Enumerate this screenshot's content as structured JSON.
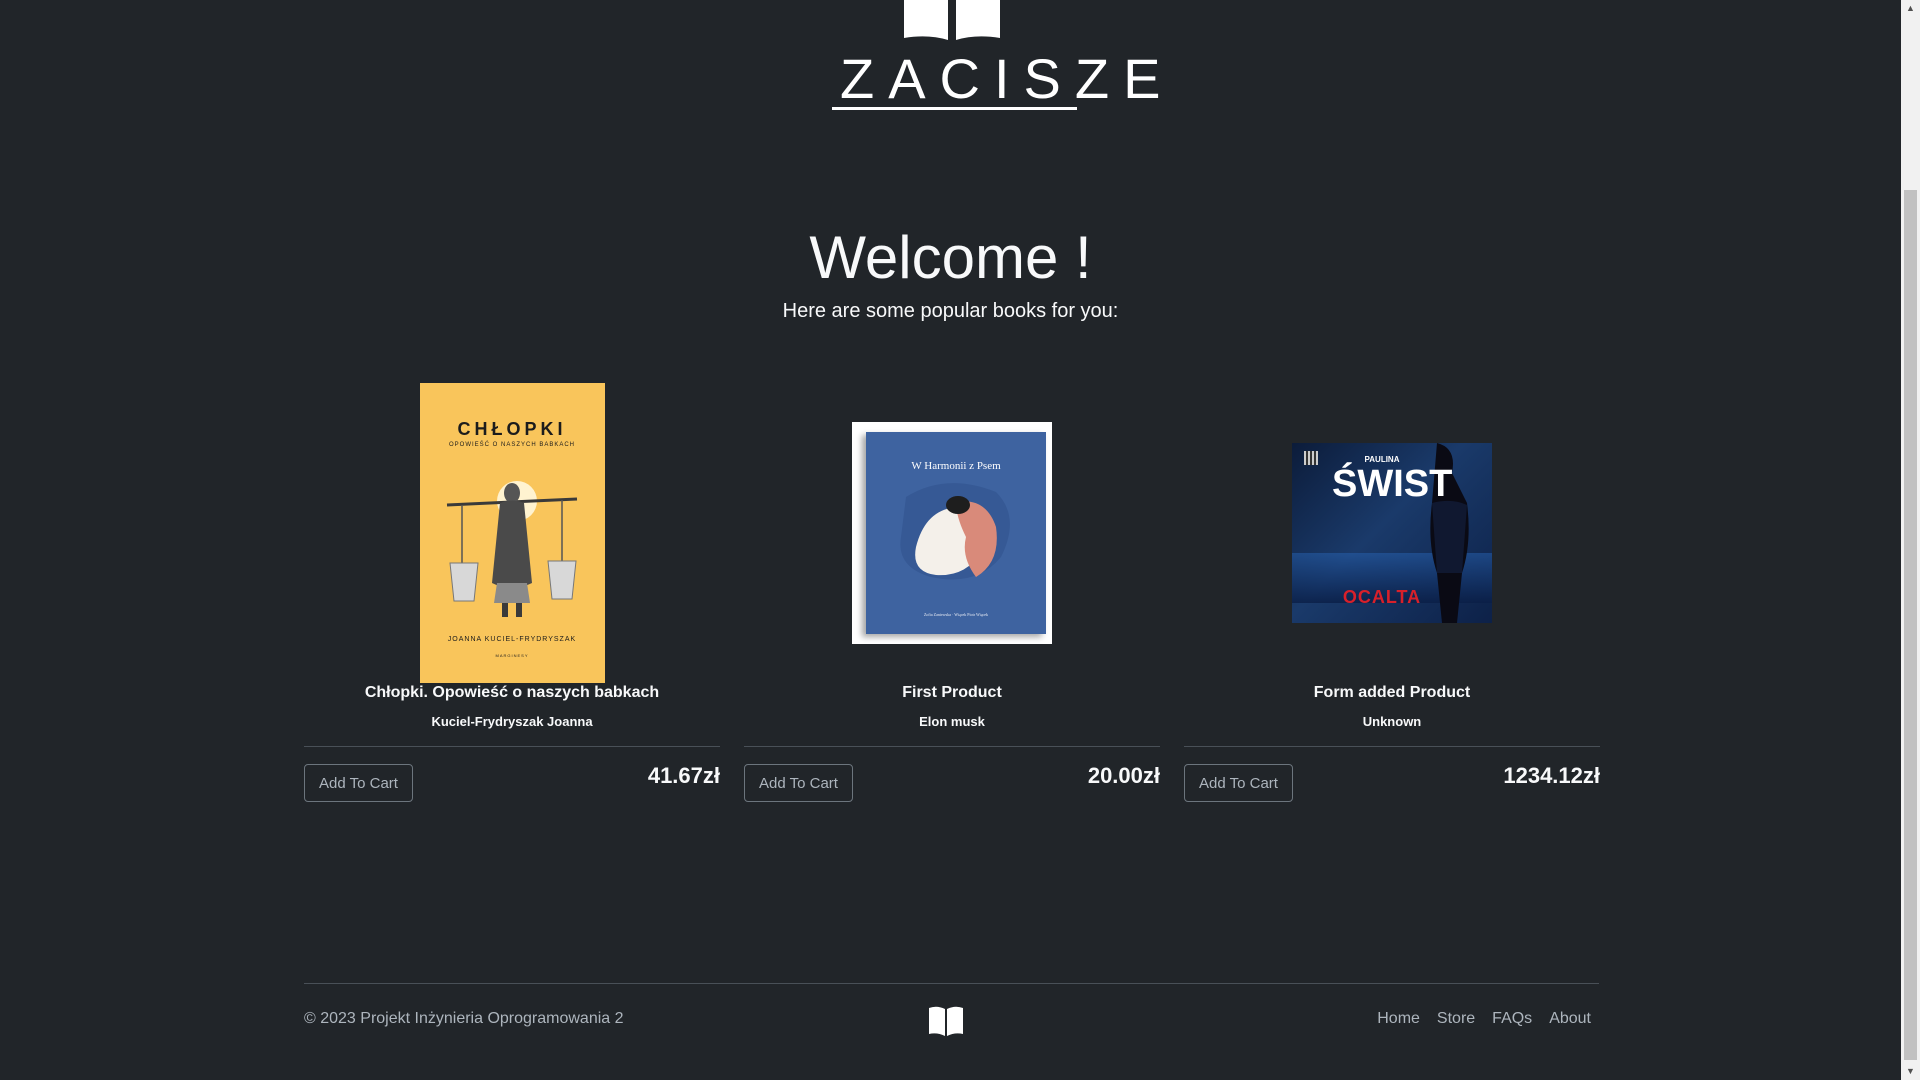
{
  "brand": {
    "name": "ZACISZE"
  },
  "hero": {
    "title": "Welcome !",
    "subtitle": "Here are some popular books for you:"
  },
  "products": [
    {
      "title": "Chłopki. Opowieść o naszych babkach",
      "author": "Kuciel-Frydryszak Joanna",
      "price": "41.67zł",
      "button_label": "Add To Cart",
      "cover": {
        "title": "CHŁOPKI",
        "subtitle": "OPOWIEŚĆ O NASZYCH BABKACH",
        "author": "JOANNA KUCIEL-FRYDRYSZAK",
        "publisher": "MARGINESY",
        "color": "#f9c55b"
      }
    },
    {
      "title": "First Product",
      "author": "Elon musk",
      "price": "20.00zł",
      "button_label": "Add To Cart",
      "cover": {
        "title": "W Harmonii z Psem",
        "authors": "Zofia Zaniewska · Wiącek Piotr Wiącek",
        "color": "#3e63a0"
      }
    },
    {
      "title": "Form added Product",
      "author": "Unknown",
      "price": "1234.12zł",
      "button_label": "Add To Cart",
      "cover": {
        "author": "PAULINA",
        "title": "ŚWIST",
        "subtitle": "OCALTA",
        "color": "#0c1c3a"
      }
    }
  ],
  "footer": {
    "copyright": "© 2023 Projekt Inżynieria Oprogramowania 2",
    "nav": [
      {
        "label": "Home"
      },
      {
        "label": "Store"
      },
      {
        "label": "FAQs"
      },
      {
        "label": "About"
      }
    ]
  },
  "colors": {
    "background": "#212529",
    "text": "#f8f9fa",
    "muted": "#adb5bd",
    "border": "#6c757d"
  }
}
